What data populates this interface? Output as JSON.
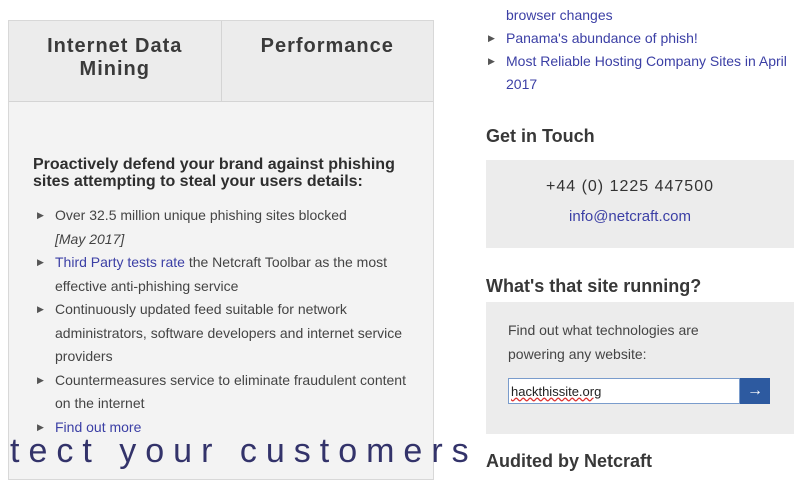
{
  "left": {
    "tabs": [
      {
        "label": "Internet Data Mining"
      },
      {
        "label": "Performance"
      }
    ],
    "headline": "Proactively defend your brand against phishing sites attempting to steal your users details:",
    "bullets": {
      "b1_text": "Over 32.5 million unique phishing sites blocked",
      "b1_date": "[May 2017]",
      "b2_link": "Third Party tests rate",
      "b2_text": " the Netcraft Toolbar as the most effective anti-phishing service",
      "b3_text": "Continuously updated feed suitable for network administrators, software developers and internet service providers",
      "b4_text": "Countermeasures service to eliminate fraudulent content on the internet",
      "b5_link": "Find out more"
    },
    "cutoff_heading": "tect your customers"
  },
  "right": {
    "news_links": [
      {
        "label": "browser changes"
      },
      {
        "label": "Panama's abundance of phish!"
      },
      {
        "label": "Most Reliable Hosting Company Sites in April 2017"
      }
    ],
    "contact": {
      "title": "Get in Touch",
      "phone": "+44 (0) 1225 447500",
      "email": "info@netcraft.com"
    },
    "site_lookup": {
      "title": "What's that site running?",
      "description": "Find out what technologies are powering any website:",
      "input_value": "hackthissite.org",
      "button_icon": "arrow-right-icon"
    },
    "audited_title": "Audited by Netcraft"
  }
}
